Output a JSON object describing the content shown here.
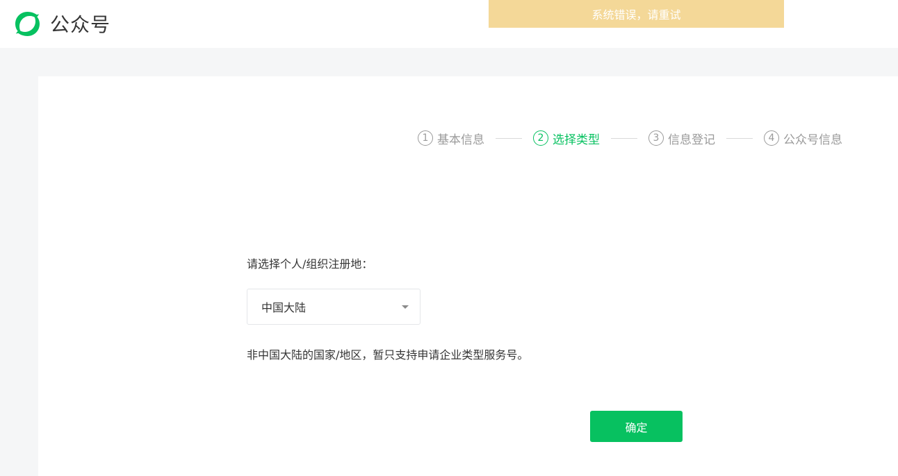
{
  "header": {
    "brand_name": "公众号",
    "logo_icon": "wechat-official-accounts-icon",
    "accent": "#07c160"
  },
  "toast": {
    "message": "系统错误，请重试",
    "color": "#f4d898"
  },
  "steps": [
    {
      "number": "1",
      "label": "基本信息",
      "active": false
    },
    {
      "number": "2",
      "label": "选择类型",
      "active": true
    },
    {
      "number": "3",
      "label": "信息登记",
      "active": false
    },
    {
      "number": "4",
      "label": "公众号信息",
      "active": false
    }
  ],
  "form": {
    "region_label": "请选择个人/组织注册地：",
    "region_value": "中国大陆",
    "note": "非中国大陆的国家/地区，暂只支持申请企业类型服务号。",
    "confirm_label": "确定"
  }
}
